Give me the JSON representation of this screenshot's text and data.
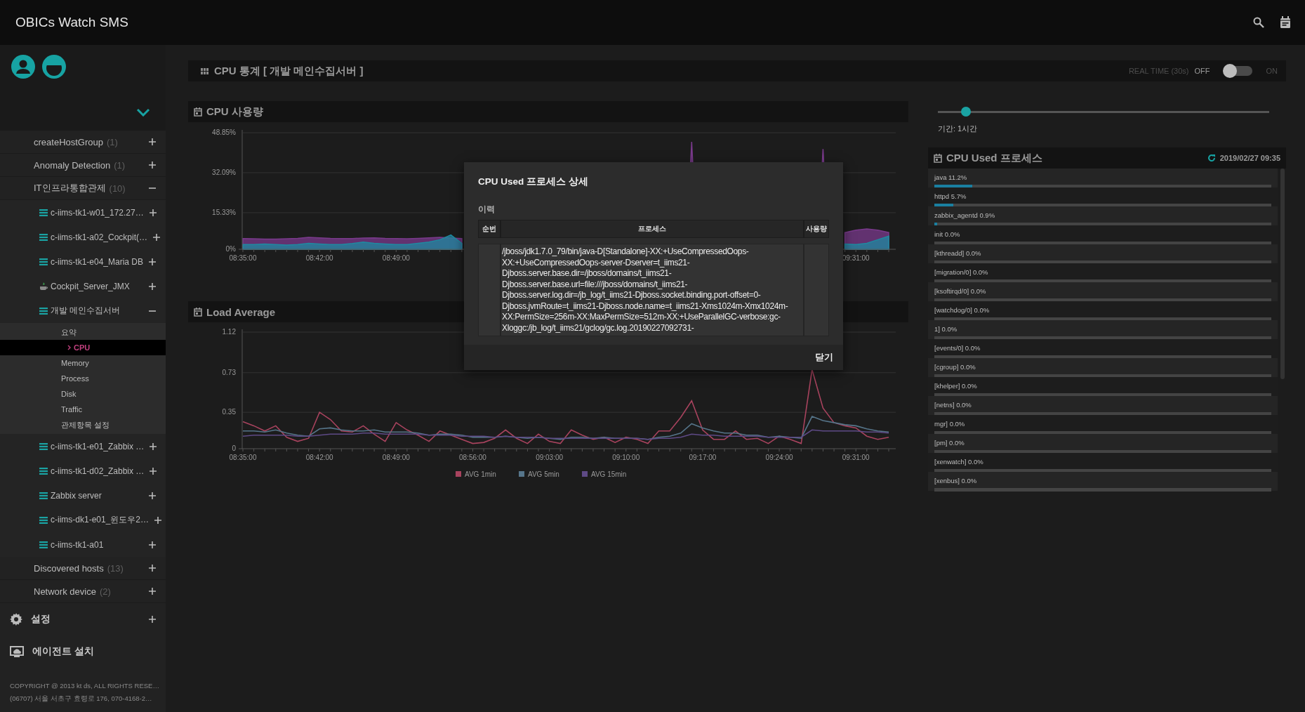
{
  "app": {
    "title": "OBICs Watch SMS"
  },
  "sidebar": {
    "groups": [
      {
        "label": "createHostGroup",
        "count": "(1)",
        "expanded": false
      },
      {
        "label": "Anomaly Detection",
        "count": "(1)",
        "expanded": false
      },
      {
        "label": "IT인프라통합관제",
        "count": "(10)",
        "expanded": true,
        "children": [
          {
            "label": "c-iims-tk1-w01_172.27…",
            "kind": "server",
            "expanded": false
          },
          {
            "label": "c-iims-tk1-a02_Cockpit(…",
            "kind": "server",
            "expanded": false
          },
          {
            "label": "c-iims-tk1-e04_Maria DB",
            "kind": "server",
            "expanded": false
          },
          {
            "label": "Cockpit_Server_JMX",
            "kind": "java",
            "expanded": false
          },
          {
            "label": "개발 메인수집서버",
            "kind": "server",
            "expanded": true,
            "children": [
              {
                "label": "요약",
                "selected": false
              },
              {
                "label": "CPU",
                "selected": true
              },
              {
                "label": "Memory",
                "selected": false
              },
              {
                "label": "Process",
                "selected": false
              },
              {
                "label": "Disk",
                "selected": false
              },
              {
                "label": "Traffic",
                "selected": false
              },
              {
                "label": "관제항목 설정",
                "selected": false
              }
            ]
          },
          {
            "label": "c-iims-tk1-e01_Zabbix …",
            "kind": "server",
            "expanded": false
          },
          {
            "label": "c-iims-tk1-d02_Zabbix …",
            "kind": "server",
            "expanded": false
          },
          {
            "label": "Zabbix server",
            "kind": "server",
            "expanded": false
          },
          {
            "label": "c-iims-dk1-e01_윈도우2…",
            "kind": "server",
            "expanded": false
          },
          {
            "label": "c-iims-tk1-a01",
            "kind": "server",
            "expanded": false
          }
        ]
      },
      {
        "label": "Discovered hosts",
        "count": "(13)",
        "expanded": false
      },
      {
        "label": "Network device",
        "count": "(2)",
        "expanded": false
      }
    ],
    "menu": [
      {
        "label": "설정",
        "kind": "gear",
        "expanded": false
      },
      {
        "label": "에이전트 설치",
        "kind": "monitor"
      }
    ],
    "footer": [
      "COPYRIGHT @ 2013 kt ds, ALL RIGHTS RESE…",
      "(06707) 서울 서초구 효령로 176, 070-4168-2…"
    ]
  },
  "header": {
    "title": "CPU 통계 [ 개발 메인수집서버 ]",
    "realtime": {
      "label": "REAL TIME (30s)",
      "off_label": "OFF",
      "on_label": "ON",
      "on": false
    }
  },
  "period": {
    "level": 0.084,
    "label": "기간: 1시간"
  },
  "cpu_usage": {
    "title": "CPU 사용량",
    "chart_data": {
      "type": "area",
      "ylim": [
        0,
        48.85
      ],
      "categories": [
        "08:35:00",
        null,
        null,
        null,
        null,
        null,
        null,
        "08:42:00",
        null,
        null,
        null,
        null,
        null,
        null,
        "08:49:00",
        null,
        null,
        null,
        null,
        null,
        null,
        null,
        null,
        null,
        null,
        null,
        null,
        null,
        null,
        null,
        null,
        null,
        null,
        null,
        null,
        null,
        null,
        null,
        null,
        null,
        null,
        null,
        null,
        null,
        null,
        null,
        null,
        null,
        null,
        null,
        null,
        null,
        null,
        null,
        null,
        null,
        "09:31:00",
        null,
        null,
        null
      ],
      "yticks": [
        {
          "value": 0,
          "label": "0%"
        },
        {
          "value": 15.33,
          "label": "15.33%"
        },
        {
          "value": 32.09,
          "label": "32.09%"
        },
        {
          "value": 48.85,
          "label": "48.85%"
        }
      ],
      "series": [
        {
          "color": "#7a3a8c",
          "values": [
            4.5,
            4.4,
            4.3,
            4.3,
            4.4,
            4.6,
            5.0,
            4.8,
            4.6,
            4.5,
            4.5,
            4.7,
            4.8,
            4.6,
            4.5,
            4.4,
            4.6,
            4.8,
            5.0,
            4.7,
            4.5,
            null,
            null,
            null,
            null,
            null,
            null,
            null,
            null,
            null,
            null,
            null,
            null,
            null,
            null,
            null,
            null,
            null,
            null,
            null,
            null,
            45.0,
            null,
            null,
            null,
            null,
            null,
            null,
            null,
            null,
            null,
            null,
            null,
            42.0,
            null,
            7.0,
            8.0,
            8.5,
            8.0,
            7.0
          ]
        },
        {
          "color": "#1f8aa0",
          "values": [
            2.0,
            2.0,
            2.2,
            2.0,
            1.8,
            2.0,
            2.5,
            2.2,
            2.0,
            2.0,
            2.4,
            3.0,
            2.5,
            2.2,
            2.0,
            2.0,
            2.5,
            3.0,
            4.0,
            6.0,
            2.5,
            null,
            null,
            null,
            null,
            null,
            null,
            null,
            null,
            null,
            null,
            null,
            null,
            null,
            null,
            null,
            null,
            null,
            null,
            null,
            null,
            null,
            null,
            null,
            null,
            null,
            null,
            null,
            null,
            null,
            null,
            null,
            null,
            null,
            null,
            2.2,
            2.0,
            2.5,
            4.0,
            5.5
          ]
        }
      ]
    }
  },
  "load_average": {
    "title": "Load Average",
    "chart_data": {
      "type": "line",
      "ylim": [
        0,
        1.12
      ],
      "legend": "bottom",
      "categories": [
        "08:35:00",
        null,
        null,
        null,
        null,
        null,
        null,
        "08:42:00",
        null,
        null,
        null,
        null,
        null,
        null,
        "08:49:00",
        null,
        null,
        null,
        null,
        null,
        null,
        "08:56:00",
        null,
        null,
        null,
        null,
        null,
        null,
        "09:03:00",
        null,
        null,
        null,
        null,
        null,
        null,
        "09:10:00",
        null,
        null,
        null,
        null,
        null,
        null,
        "09:17:00",
        null,
        null,
        null,
        null,
        null,
        null,
        "09:24:00",
        null,
        null,
        null,
        null,
        null,
        null,
        "09:31:00",
        null,
        null,
        null
      ],
      "yticks": [
        0,
        0.35,
        0.73,
        1.12
      ],
      "series": [
        {
          "name": "AVG 1min",
          "color": "#a8435e",
          "values": [
            0.26,
            0.22,
            0.17,
            0.22,
            0.11,
            0.07,
            0.1,
            0.35,
            0.28,
            0.17,
            0.16,
            0.22,
            0.14,
            0.07,
            0.25,
            0.18,
            0.13,
            0.07,
            0.17,
            0.13,
            0.09,
            0.05,
            0.06,
            0.1,
            0.18,
            0.1,
            0.05,
            0.14,
            0.07,
            0.05,
            0.18,
            0.13,
            0.09,
            0.11,
            0.06,
            0.11,
            0.09,
            0.05,
            0.17,
            0.17,
            0.3,
            0.46,
            0.18,
            0.09,
            0.09,
            0.17,
            0.09,
            0.1,
            0.05,
            0.12,
            0.09,
            0.05,
            0.76,
            0.39,
            0.25,
            0.22,
            0.2,
            0.12,
            0.09,
            0.11
          ]
        },
        {
          "name": "AVG 5min",
          "color": "#56758a",
          "values": [
            0.17,
            0.17,
            0.16,
            0.18,
            0.15,
            0.13,
            0.12,
            0.19,
            0.2,
            0.18,
            0.17,
            0.17,
            0.18,
            0.16,
            0.16,
            0.16,
            0.15,
            0.13,
            0.14,
            0.14,
            0.13,
            0.11,
            0.11,
            0.11,
            0.12,
            0.11,
            0.1,
            0.11,
            0.1,
            0.09,
            0.11,
            0.11,
            0.1,
            0.11,
            0.1,
            0.1,
            0.1,
            0.09,
            0.11,
            0.12,
            0.15,
            0.24,
            0.2,
            0.17,
            0.15,
            0.15,
            0.13,
            0.13,
            0.11,
            0.12,
            0.11,
            0.1,
            0.31,
            0.27,
            0.25,
            0.23,
            0.22,
            0.19,
            0.17,
            0.16
          ]
        },
        {
          "name": "AVG 15min",
          "color": "#5e4a86",
          "values": [
            0.12,
            0.13,
            0.13,
            0.13,
            0.13,
            0.12,
            0.12,
            0.13,
            0.14,
            0.14,
            0.14,
            0.15,
            0.15,
            0.14,
            0.14,
            0.14,
            0.14,
            0.13,
            0.13,
            0.13,
            0.12,
            0.12,
            0.12,
            0.11,
            0.12,
            0.11,
            0.11,
            0.11,
            0.1,
            0.1,
            0.1,
            0.1,
            0.1,
            0.1,
            0.1,
            0.1,
            0.1,
            0.09,
            0.1,
            0.1,
            0.11,
            0.14,
            0.13,
            0.13,
            0.12,
            0.12,
            0.12,
            0.12,
            0.11,
            0.11,
            0.11,
            0.11,
            0.18,
            0.17,
            0.17,
            0.17,
            0.17,
            0.16,
            0.16,
            0.15
          ]
        }
      ]
    }
  },
  "cpu_processes": {
    "title": "CPU Used 프로세스",
    "timestamp": "2019/02/27 09:35",
    "items": [
      {
        "label": "java 11.2%",
        "level": 0.112
      },
      {
        "label": "httpd 5.7%",
        "level": 0.057
      },
      {
        "label": "zabbix_agentd 0.9%",
        "level": 0.009
      },
      {
        "label": "init 0.0%",
        "level": 0
      },
      {
        "label": "[kthreadd] 0.0%",
        "level": 0
      },
      {
        "label": "[migration/0] 0.0%",
        "level": 0
      },
      {
        "label": "[ksoftirqd/0] 0.0%",
        "level": 0
      },
      {
        "label": "[watchdog/0] 0.0%",
        "level": 0
      },
      {
        "label": "1] 0.0%",
        "level": 0
      },
      {
        "label": "[events/0] 0.0%",
        "level": 0
      },
      {
        "label": "[cgroup] 0.0%",
        "level": 0
      },
      {
        "label": "[khelper] 0.0%",
        "level": 0
      },
      {
        "label": "[netns] 0.0%",
        "level": 0
      },
      {
        "label": "mgr] 0.0%",
        "level": 0
      },
      {
        "label": "[pm] 0.0%",
        "level": 0
      },
      {
        "label": "[xenwatch] 0.0%",
        "level": 0
      },
      {
        "label": "[xenbus] 0.0%",
        "level": 0
      }
    ]
  },
  "dialog": {
    "title": "CPU Used 프로세스 상세",
    "section": "이력",
    "columns": [
      "순번",
      "프로세스",
      "사용량"
    ],
    "rows": [
      {
        "process": "/jboss/jdk1.7.0_79/bin/java-D[Standalone]-XX:+UseCompressedOops-XX:+UseCompressedOops-server-Dserver=t_iims21-Djboss.server.base.dir=/jboss/domains/t_iims21-Djboss.server.base.url=file:///jboss/domains/t_iims21-Djboss.server.log.dir=/jb_log/t_iims21-Djboss.socket.binding.port-offset=0-Djboss.jvmRoute=t_iims21-Djboss.node.name=t_iims21-Xms1024m-Xmx1024m-XX:PermSize=256m-XX:MaxPermSize=512m-XX:+UseParallelGC-verbose:gc-Xloggc:/jb_log/t_iims21/gclog/gc.log.20190227092731-"
      }
    ],
    "close_button": "닫기"
  }
}
